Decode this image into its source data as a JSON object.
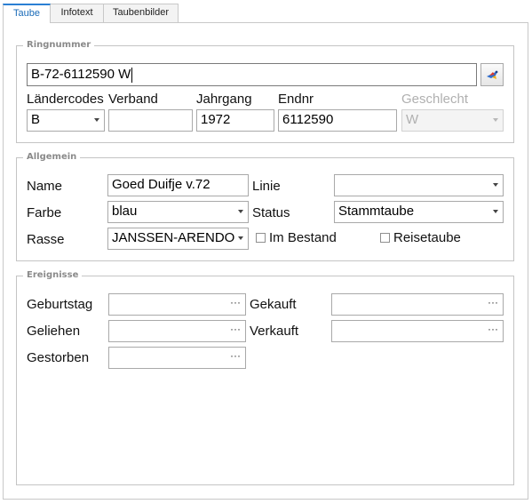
{
  "tabs": [
    {
      "label": "Taube"
    },
    {
      "label": "Infotext"
    },
    {
      "label": "Taubenbilder"
    }
  ],
  "ringnummer": {
    "legend": "Ringnummer",
    "value": "B-72-6112590 W",
    "laendercodes": {
      "label": "Ländercodes",
      "value": "B"
    },
    "verband": {
      "label": "Verband",
      "value": ""
    },
    "jahrgang": {
      "label": "Jahrgang",
      "value": "1972"
    },
    "endnr": {
      "label": "Endnr",
      "value": "6112590"
    },
    "geschlecht": {
      "label": "Geschlecht",
      "value": "W"
    }
  },
  "allgemein": {
    "legend": "Allgemein",
    "name": {
      "label": "Name",
      "value": "Goed Duifje v.72"
    },
    "farbe": {
      "label": "Farbe",
      "value": "blau"
    },
    "rasse": {
      "label": "Rasse",
      "value": "JANSSEN-ARENDO"
    },
    "linie": {
      "label": "Linie",
      "value": ""
    },
    "status": {
      "label": "Status",
      "value": "Stammtaube"
    },
    "im_bestand": {
      "label": "Im Bestand",
      "checked": false
    },
    "reisetaube": {
      "label": "Reisetaube",
      "checked": false
    }
  },
  "ereignisse": {
    "legend": "Ereignisse",
    "geburtstag": {
      "label": "Geburtstag",
      "value": ""
    },
    "geliehen": {
      "label": "Geliehen",
      "value": ""
    },
    "gestorben": {
      "label": "Gestorben",
      "value": ""
    },
    "gekauft": {
      "label": "Gekauft",
      "value": ""
    },
    "verkauft": {
      "label": "Verkauft",
      "value": ""
    },
    "ellipsis": "···"
  },
  "icons": {
    "lookup": "pigeon-lookup-icon",
    "dropdown": "chevron-down-icon",
    "ellipsis": "ellipsis-icon"
  }
}
